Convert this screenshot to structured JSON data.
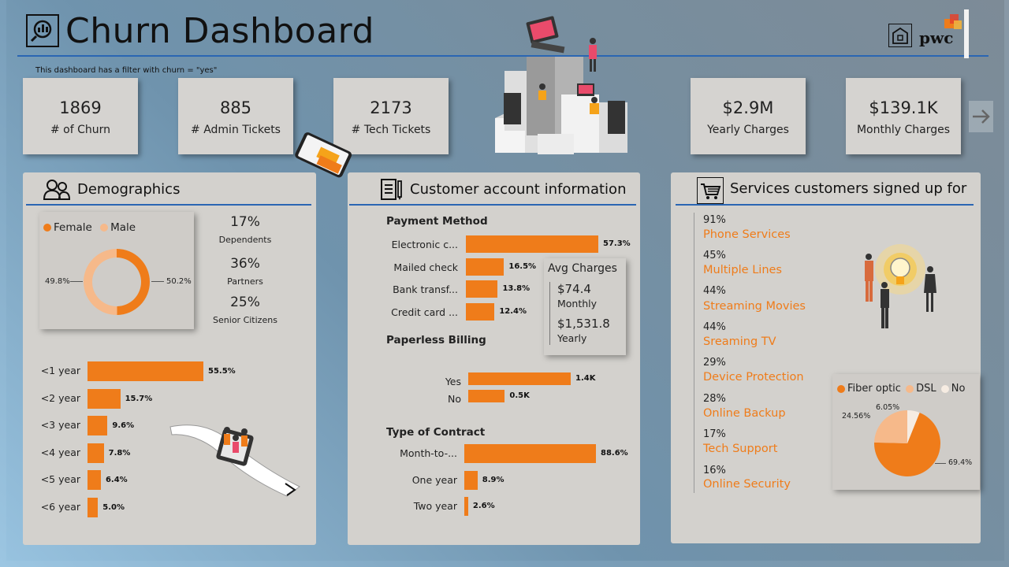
{
  "header": {
    "title": "Churn Dashboard",
    "filter_note": "This dashboard has a filter with churn = \"yes\"",
    "brand": "pwc"
  },
  "kpis": [
    {
      "value": "1869",
      "label": "# of Churn"
    },
    {
      "value": "885",
      "label": "# Admin Tickets"
    },
    {
      "value": "2173",
      "label": "# Tech Tickets"
    },
    {
      "value": "$2.9M",
      "label": "Yearly Charges"
    },
    {
      "value": "$139.1K",
      "label": "Monthly Charges"
    }
  ],
  "demographics": {
    "title": "Demographics",
    "gender_legend": [
      {
        "label": "Female",
        "color": "#ef7c1a"
      },
      {
        "label": "Male",
        "color": "#f6b98a"
      }
    ],
    "gender_left": "49.8%",
    "gender_right": "50.2%",
    "stats": [
      {
        "value": "17%",
        "label": "Dependents"
      },
      {
        "value": "36%",
        "label": "Partners"
      },
      {
        "value": "25%",
        "label": "Senior Citizens"
      }
    ],
    "tenure": [
      {
        "label": "<1 year",
        "value": "55.5%",
        "pct": 55.5
      },
      {
        "label": "<2 year",
        "value": "15.7%",
        "pct": 15.7
      },
      {
        "label": "<3 year",
        "value": "9.6%",
        "pct": 9.6
      },
      {
        "label": "<4 year",
        "value": "7.8%",
        "pct": 7.8
      },
      {
        "label": "<5 year",
        "value": "6.4%",
        "pct": 6.4
      },
      {
        "label": "<6 year",
        "value": "5.0%",
        "pct": 5.0
      }
    ]
  },
  "account": {
    "title": "Customer account information",
    "payment_title": "Payment Method",
    "payment": [
      {
        "label": "Electronic c...",
        "value": "57.3%",
        "pct": 57.3
      },
      {
        "label": "Mailed check",
        "value": "16.5%",
        "pct": 16.5
      },
      {
        "label": "Bank transf...",
        "value": "13.8%",
        "pct": 13.8
      },
      {
        "label": "Credit card ...",
        "value": "12.4%",
        "pct": 12.4
      }
    ],
    "avg_charges": {
      "title": "Avg Charges",
      "monthly_value": "$74.4",
      "monthly_label": "Monthly",
      "yearly_value": "$1,531.8",
      "yearly_label": "Yearly"
    },
    "paperless_title": "Paperless Billing",
    "paperless": [
      {
        "label": "Yes",
        "value": "1.4K",
        "num": 1.4
      },
      {
        "label": "No",
        "value": "0.5K",
        "num": 0.5
      }
    ],
    "contract_title": "Type of Contract",
    "contract": [
      {
        "label": "Month-to-...",
        "value": "88.6%",
        "pct": 88.6
      },
      {
        "label": "One year",
        "value": "8.9%",
        "pct": 8.9
      },
      {
        "label": "Two year",
        "value": "2.6%",
        "pct": 2.6
      }
    ]
  },
  "services": {
    "title": "Services customers signed up for",
    "items": [
      {
        "pct": "91%",
        "name": "Phone Services"
      },
      {
        "pct": "45%",
        "name": "Multiple Lines"
      },
      {
        "pct": "44%",
        "name": "Streaming Movies"
      },
      {
        "pct": "44%",
        "name": "Sreaming TV"
      },
      {
        "pct": "29%",
        "name": "Device Protection"
      },
      {
        "pct": "28%",
        "name": "Online Backup"
      },
      {
        "pct": "17%",
        "name": "Tech Support"
      },
      {
        "pct": "16%",
        "name": "Online Security"
      }
    ],
    "internet_legend": [
      {
        "label": "Fiber optic",
        "color": "#ef7c1a"
      },
      {
        "label": "DSL",
        "color": "#f6b98a"
      },
      {
        "label": "No",
        "color": "#f6ece2"
      }
    ],
    "internet_labels": {
      "fiber": "69.4%",
      "dsl": "24.56%",
      "no": "6.05%"
    }
  },
  "chart_data": [
    {
      "type": "pie",
      "title": "",
      "categories": [
        "Female",
        "Male"
      ],
      "values": [
        49.8,
        50.2
      ]
    },
    {
      "type": "bar",
      "title": "",
      "categories": [
        "<1 year",
        "<2 year",
        "<3 year",
        "<4 year",
        "<5 year",
        "<6 year"
      ],
      "values": [
        55.5,
        15.7,
        9.6,
        7.8,
        6.4,
        5.0
      ]
    },
    {
      "type": "bar",
      "title": "Payment Method",
      "categories": [
        "Electronic c...",
        "Mailed check",
        "Bank transf...",
        "Credit card ..."
      ],
      "values": [
        57.3,
        16.5,
        13.8,
        12.4
      ]
    },
    {
      "type": "bar",
      "title": "Paperless Billing",
      "categories": [
        "Yes",
        "No"
      ],
      "values": [
        1.4,
        0.5
      ]
    },
    {
      "type": "bar",
      "title": "Type of Contract",
      "categories": [
        "Month-to-...",
        "One year",
        "Two year"
      ],
      "values": [
        88.6,
        8.9,
        2.6
      ]
    },
    {
      "type": "pie",
      "title": "",
      "categories": [
        "Fiber optic",
        "DSL",
        "No"
      ],
      "values": [
        69.4,
        24.56,
        6.05
      ]
    }
  ]
}
